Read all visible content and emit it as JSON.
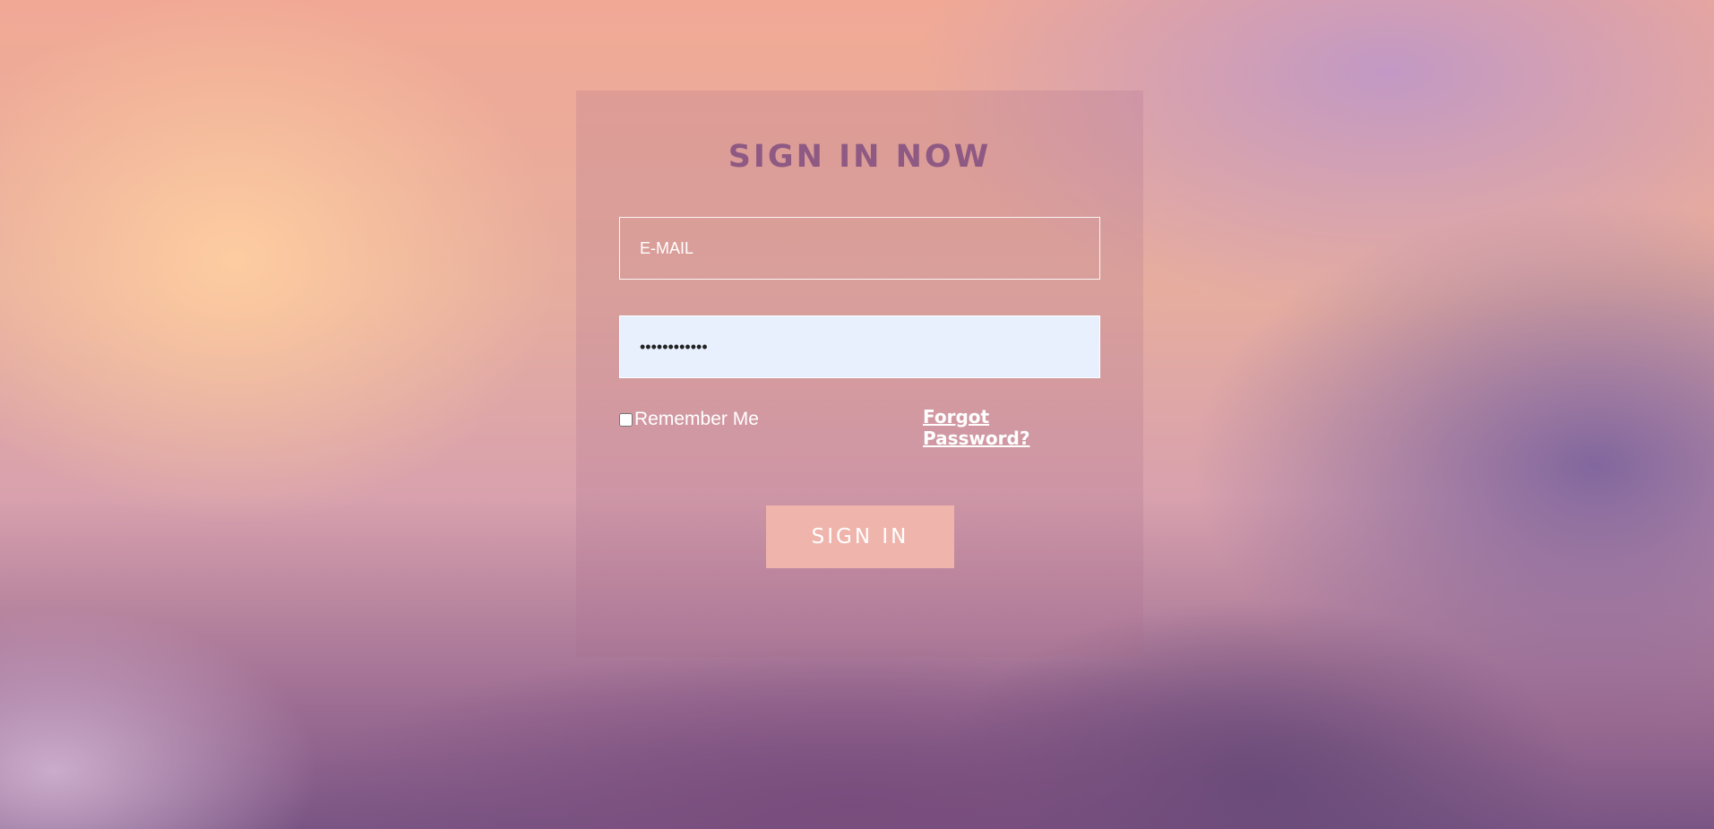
{
  "form": {
    "title": "SIGN IN NOW",
    "email_placeholder": "E-MAIL",
    "email_value": "",
    "password_value": "............",
    "remember_label": "Remember Me",
    "remember_checked": false,
    "forgot_label": "Forgot Password?",
    "submit_label": "SIGN IN"
  },
  "colors": {
    "title": "#8e5a83",
    "button": "#efb5ad",
    "password_fill": "#e8f0fe"
  }
}
